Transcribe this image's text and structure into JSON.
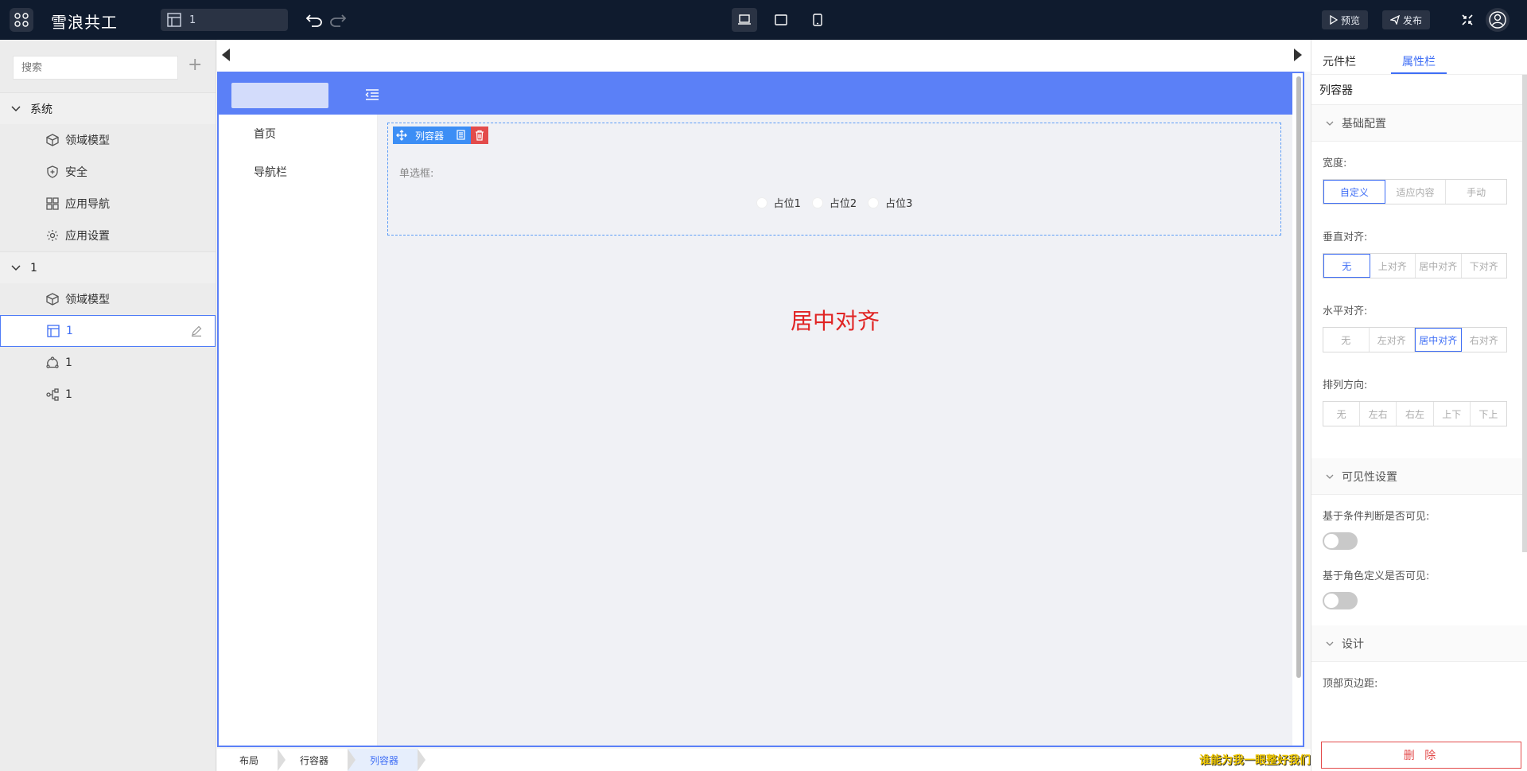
{
  "topbar": {
    "brand": "雪浪共工",
    "page_selector": "1",
    "preview_label": "预览",
    "publish_label": "发布"
  },
  "sidebar": {
    "search_placeholder": "搜索",
    "groups": [
      {
        "label": "系统",
        "items": [
          "领域模型",
          "安全",
          "应用导航",
          "应用设置"
        ]
      },
      {
        "label": "1",
        "items": [
          "领域模型",
          "1",
          "1",
          "1"
        ]
      }
    ]
  },
  "app": {
    "nav": [
      "首页",
      "导航栏"
    ],
    "column_toolbar_label": "列容器",
    "radio_label": "单选框:",
    "radios": [
      "占位1",
      "占位2",
      "占位3"
    ],
    "center_text": "居中对齐"
  },
  "breadcrumb": [
    "布局",
    "行容器",
    "列容器"
  ],
  "tip": "谁能为我一眼整好我们",
  "panel": {
    "tabs": [
      "元件栏",
      "属性栏"
    ],
    "title": "列容器",
    "sections": [
      "基础配置",
      "可见性设置",
      "设计"
    ],
    "width_label": "宽度:",
    "width_options": [
      "自定义",
      "适应内容",
      "手动"
    ],
    "valign_label": "垂直对齐:",
    "valign_options": [
      "无",
      "上对齐",
      "居中对齐",
      "下对齐"
    ],
    "halign_label": "水平对齐:",
    "halign_options": [
      "无",
      "左对齐",
      "居中对齐",
      "右对齐"
    ],
    "direction_label": "排列方向:",
    "direction_options": [
      "无",
      "左右",
      "右左",
      "上下",
      "下上"
    ],
    "cond_visible_label": "基于条件判断是否可见:",
    "role_visible_label": "基于角色定义是否可见:",
    "top_margin_label": "顶部页边距:",
    "delete_label": "删 除"
  },
  "colors": {
    "accent": "#3f6ef5",
    "header": "#5b80f7",
    "danger": "#e02424",
    "topbar": "#0f1b2e"
  }
}
